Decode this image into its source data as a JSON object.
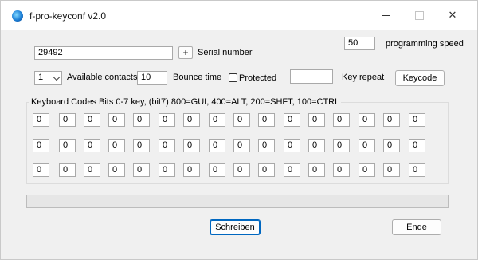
{
  "window": {
    "title": "f-pro-keyconf v2.0"
  },
  "serial": {
    "value": "29492",
    "add_label": "+",
    "label": "Serial number"
  },
  "speed": {
    "value": "50",
    "label": "programming speed"
  },
  "contacts": {
    "selected": "1",
    "label": "Available contacts"
  },
  "bounce": {
    "value": "10",
    "label": "Bounce time"
  },
  "protected": {
    "label": "Protected",
    "checked": false
  },
  "key_repeat": {
    "value": "",
    "label": "Key repeat"
  },
  "keycode_button": {
    "label": "Keycode"
  },
  "codes_group": {
    "label": "Keyboard Codes Bits 0-7 key, (bit7)  800=GUI, 400=ALT, 200=SHFT, 100=CTRL",
    "rows": [
      [
        "0",
        "0",
        "0",
        "0",
        "0",
        "0",
        "0",
        "0",
        "0",
        "0",
        "0",
        "0",
        "0",
        "0",
        "0",
        "0"
      ],
      [
        "0",
        "0",
        "0",
        "0",
        "0",
        "0",
        "0",
        "0",
        "0",
        "0",
        "0",
        "0",
        "0",
        "0",
        "0",
        "0"
      ],
      [
        "0",
        "0",
        "0",
        "0",
        "0",
        "0",
        "0",
        "0",
        "0",
        "0",
        "0",
        "0",
        "0",
        "0",
        "0",
        "0"
      ]
    ]
  },
  "progress": {
    "value": 0
  },
  "buttons": {
    "write": "Schreiben",
    "end": "Ende"
  }
}
